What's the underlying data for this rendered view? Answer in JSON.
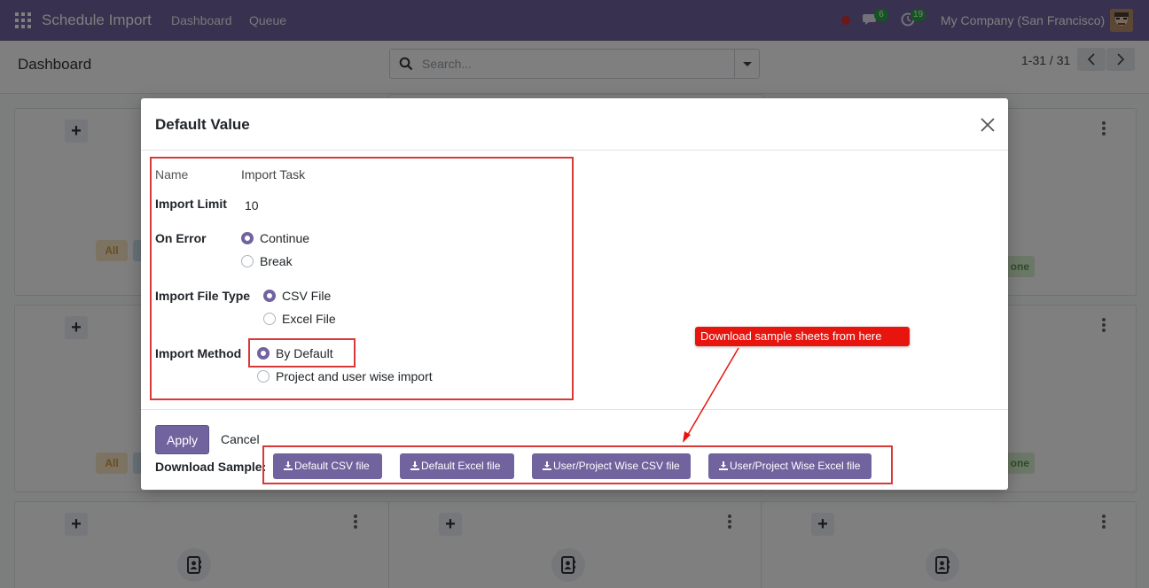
{
  "navbar": {
    "app_title": "Schedule Import",
    "links": [
      "Dashboard",
      "Queue"
    ],
    "messages_count": "6",
    "activities_count": "19",
    "company": "My Company (San Francisco)"
  },
  "control_panel": {
    "title": "Dashboard",
    "search_placeholder": "Search...",
    "pager": "1-31 / 31"
  },
  "kanban": {
    "tag_all": "All",
    "tag_done": "one"
  },
  "modal": {
    "title": "Default Value",
    "fields": {
      "name_label": "Name",
      "name_value": "Import Task",
      "import_limit_label": "Import Limit",
      "import_limit_value": "10",
      "on_error_label": "On Error",
      "on_error_options": [
        "Continue",
        "Break"
      ],
      "on_error_selected": "Continue",
      "file_type_label": "Import File Type",
      "file_type_options": [
        "CSV File",
        "Excel File"
      ],
      "file_type_selected": "CSV File",
      "method_label": "Import Method",
      "method_options": [
        "By Default",
        "Project and user wise import"
      ],
      "method_selected": "By Default"
    },
    "footer": {
      "apply": "Apply",
      "cancel": "Cancel",
      "download_label": "Download Sample:",
      "samples": [
        "Default CSV file",
        "Default Excel file",
        "User/Project Wise CSV file",
        "User/Project Wise Excel file"
      ]
    }
  },
  "annotation": {
    "text": "Download sample sheets from here",
    "color": "#e8150f"
  },
  "colors": {
    "primary": "#71639e",
    "highlight": "#d93838"
  }
}
